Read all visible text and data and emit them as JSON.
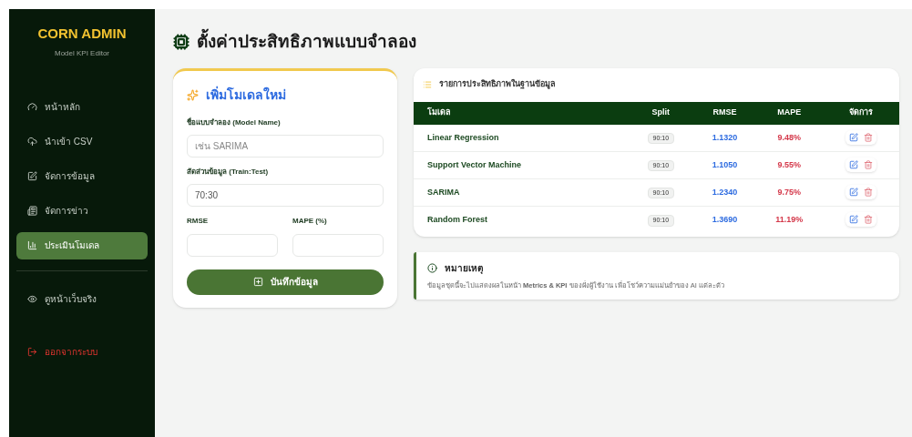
{
  "sidebar": {
    "brand": "CORN ADMIN",
    "subtitle": "Model KPI Editor",
    "items": [
      {
        "label": "หน้าหลัก",
        "kind": "nav",
        "selected": false
      },
      {
        "label": "นำเข้า CSV",
        "kind": "nav",
        "selected": false
      },
      {
        "label": "จัดการข้อมูล",
        "kind": "nav",
        "selected": false
      },
      {
        "label": "จัดการข่าว",
        "kind": "nav",
        "selected": false
      },
      {
        "label": "ประเมินโมเดล",
        "kind": "nav",
        "selected": true
      },
      {
        "label": "ดูหน้าเว็บจริง",
        "kind": "external",
        "selected": false
      },
      {
        "label": "ออกจากระบบ",
        "kind": "logout",
        "selected": false
      }
    ]
  },
  "page_title": "ตั้งค่าประสิทธิภาพแบบจำลอง",
  "form": {
    "title": "เพิ่มโมเดลใหม่",
    "fields": [
      {
        "label": "ชื่อแบบจำลอง (Model Name)",
        "placeholder": "เช่น SARIMA"
      },
      {
        "label": "สัดส่วนข้อมูล (Train:Test)",
        "value": "70:30"
      }
    ],
    "metric_fields": [
      {
        "label": "RMSE"
      },
      {
        "label": "MAPE (%)"
      }
    ],
    "submit": "บันทึกข้อมูล"
  },
  "table": {
    "title": "รายการประสิทธิภาพในฐานข้อมูล",
    "columns": [
      "โมเดล",
      "Split",
      "RMSE",
      "MAPE",
      "จัดการ"
    ],
    "rows": [
      {
        "model": "Linear Regression",
        "split": "90:10",
        "rmse": "1.1320",
        "mape": "9.48%"
      },
      {
        "model": "Support Vector Machine",
        "split": "90:10",
        "rmse": "1.1050",
        "mape": "9.55%"
      },
      {
        "model": "SARIMA",
        "split": "90:10",
        "rmse": "1.2340",
        "mape": "9.75%"
      },
      {
        "model": "Random Forest",
        "split": "90:10",
        "rmse": "1.3690",
        "mape": "11.19%"
      }
    ]
  },
  "note": {
    "title": "หมายเหตุ",
    "text": "ข้อมูลชุดนี้จะไปแสดงผลในหน้า **Metrics & KPI** ของฝั่งผู้ใช้งาน เพื่อโชว์ความแม่นยำของ AI แต่ละตัว"
  }
}
